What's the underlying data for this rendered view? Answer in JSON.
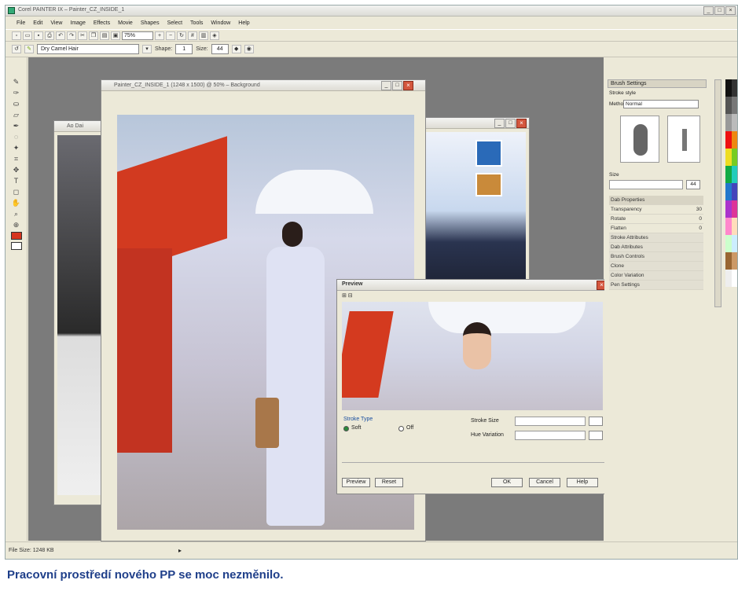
{
  "window": {
    "title": "Corel PAINTER IX – Painter_CZ_INSIDE_1",
    "controls": [
      "_",
      "□",
      "×"
    ]
  },
  "menu": {
    "items": [
      "File",
      "Edit",
      "View",
      "Image",
      "Effects",
      "Movie",
      "Shapes",
      "Select",
      "Tools",
      "Window",
      "Help"
    ]
  },
  "toolbar": {
    "zoom": "75%"
  },
  "property_bar": {
    "brush_variant": "Dry Camel Hair",
    "shape_label": "Shape:",
    "shape_value": "1",
    "size_label": "Size:",
    "size_value": "44"
  },
  "documents": {
    "front": {
      "title": "Painter_CZ_INSIDE_1 (1248 x 1500) @ 50% – Background"
    },
    "back_left": {
      "title": "Ao Dai"
    },
    "back_right": {
      "title": ""
    }
  },
  "dialog": {
    "title": "Preview",
    "stroke_type_label": "Stroke Type",
    "option_soft": "Soft",
    "option_hard": "Off",
    "stroke_size_label": "Stroke Size",
    "hue_label": "Hue Variation",
    "buttons": {
      "preview": "Preview",
      "reset": "Reset",
      "ok": "OK",
      "cancel": "Cancel",
      "help": "Help"
    }
  },
  "brush_panel": {
    "title": "Brush Settings",
    "stroke_label": "Stroke style",
    "method_label": "Method",
    "method_value": "Normal",
    "size_label": "Size",
    "size_value": "44",
    "properties_header": "Dab Properties",
    "properties": [
      {
        "name": "Transparency",
        "value": "30"
      },
      {
        "name": "Rotate",
        "value": "0"
      },
      {
        "name": "Flatten",
        "value": "0"
      }
    ],
    "sections": [
      "Stroke Attributes",
      "Dab Attributes",
      "Brush Controls",
      "Clone",
      "Color Variation",
      "Pen Settings"
    ]
  },
  "status": {
    "text": "File Size: 1248 KB"
  },
  "caption": {
    "text": "Pracovní prostředí nového PP se moc nezměnilo."
  },
  "colors": {
    "caption": "#1f3f8a",
    "workspace": "#7b7b7b",
    "chrome": "#ece9d8",
    "close": "#d4573e"
  }
}
